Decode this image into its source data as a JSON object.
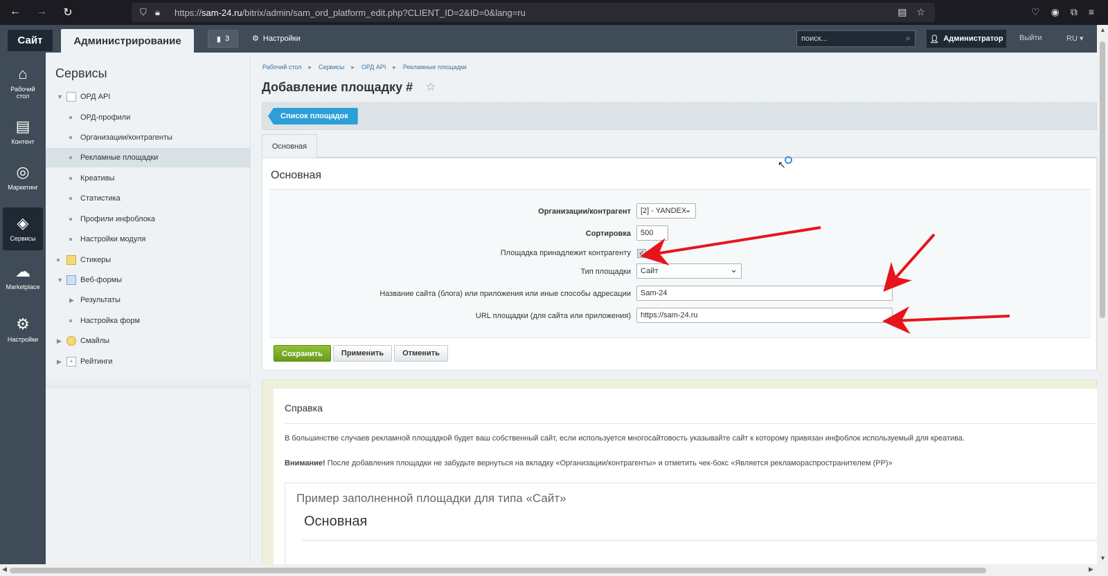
{
  "browser": {
    "url_prefix": "https://",
    "url_domain": "sam-24.ru",
    "url_path": "/bitrix/admin/sam_ord_platform_edit.php?CLIENT_ID=2&ID=0&lang=ru"
  },
  "topbar": {
    "site_tab": "Сайт",
    "admin_tab": "Администрирование",
    "notifications_count": "3",
    "settings": "Настройки",
    "search_placeholder": "поиск...",
    "user": "Администратор",
    "logout": "Выйти",
    "lang": "RU"
  },
  "leftpanel": [
    {
      "label": "Рабочий стол",
      "icon": "home-icon"
    },
    {
      "label": "Контент",
      "icon": "document-icon"
    },
    {
      "label": "Маркетинг",
      "icon": "target-icon"
    },
    {
      "label": "Сервисы",
      "icon": "layers-icon"
    },
    {
      "label": "Marketplace",
      "icon": "cloud-download-icon"
    },
    {
      "label": "Настройки",
      "icon": "gear-icon"
    }
  ],
  "menu": {
    "title": "Сервисы",
    "items": [
      {
        "label": "ОРД API"
      },
      {
        "label": "ОРД-профили"
      },
      {
        "label": "Организации/контрагенты"
      },
      {
        "label": "Рекламные площадки"
      },
      {
        "label": "Креативы"
      },
      {
        "label": "Статистика"
      },
      {
        "label": "Профили инфоблока"
      },
      {
        "label": "Настройки модуля"
      },
      {
        "label": "Стикеры"
      },
      {
        "label": "Веб-формы"
      },
      {
        "label": "Результаты"
      },
      {
        "label": "Настройка форм"
      },
      {
        "label": "Смайлы"
      },
      {
        "label": "Рейтинги"
      }
    ]
  },
  "breadcrumbs": [
    "Рабочий стол",
    "Сервисы",
    "ОРД API",
    "Рекламные площадки"
  ],
  "page_title": "Добавление площадку #",
  "list_button": "Список площадок",
  "tab_main": "Основная",
  "form": {
    "section_title": "Основная",
    "org_label": "Организации/контрагент",
    "org_value": "[2] - YANDEX",
    "sort_label": "Сортировка",
    "sort_value": "500",
    "belongs_label": "Площадка принадлежит контрагенту",
    "belongs_mark": "✓",
    "type_label": "Тип площадки",
    "type_value": "Сайт",
    "name_label": "Название сайта (блога) или приложения или иные способы адресации",
    "name_value": "Sam-24",
    "url_label": "URL площадки (для сайта или приложения)",
    "url_value": "https://sam-24.ru"
  },
  "buttons": {
    "save": "Сохранить",
    "apply": "Применить",
    "cancel": "Отменить"
  },
  "help": {
    "title": "Справка",
    "text1": "В большинстве случаев рекламной площадкой будет ваш собственный сайт, если используется многосайтовость указывайте сайт к которому привязан инфоблок используемый для креатива.",
    "attention": "Внимание!",
    "text2": " После добавления площадки не забудьте вернуться на вкладку «Организации/контрагенты» и отметить чек-бокс «Является рекламораспространителем (РР)»",
    "example_title": "Пример заполненной площадки для типа «Сайт»",
    "example_heading": "Основная"
  },
  "colors": {
    "annotation_arrow": "#e8141b",
    "save_green": "#7ab02a",
    "list_blue": "#2d9fd8"
  }
}
